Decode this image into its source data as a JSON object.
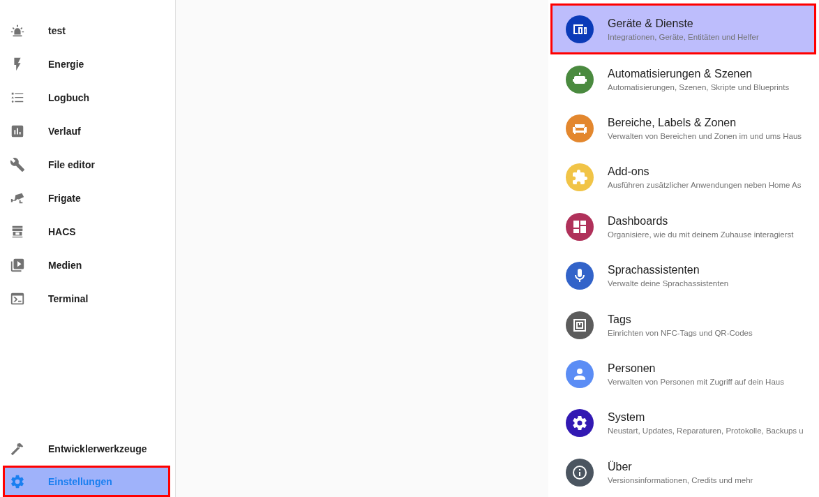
{
  "sidebar": {
    "items": [
      {
        "kind": "alarm",
        "label": "test",
        "selected": false
      },
      {
        "kind": "flash",
        "label": "Energie",
        "selected": false
      },
      {
        "kind": "list",
        "label": "Logbuch",
        "selected": false
      },
      {
        "kind": "chart",
        "label": "Verlauf",
        "selected": false
      },
      {
        "kind": "wrench",
        "label": "File editor",
        "selected": false
      },
      {
        "kind": "camera",
        "label": "Frigate",
        "selected": false
      },
      {
        "kind": "store",
        "label": "HACS",
        "selected": false
      },
      {
        "kind": "media",
        "label": "Medien",
        "selected": false
      },
      {
        "kind": "console",
        "label": "Terminal",
        "selected": false
      }
    ],
    "bottom_items": [
      {
        "kind": "hammer",
        "label": "Entwicklerwerkzeuge",
        "selected": false
      },
      {
        "kind": "cog",
        "label": "Einstellungen",
        "selected": true
      }
    ]
  },
  "settings": {
    "items": [
      {
        "kind": "devices",
        "title": "Geräte & Dienste",
        "subtitle": "Integrationen, Geräte, Entitäten und Helfer",
        "color": "#0b3bb8",
        "selected": true
      },
      {
        "kind": "robot",
        "title": "Automatisierungen & Szenen",
        "subtitle": "Automatisierungen, Szenen, Skripte und Blueprints",
        "color": "#4a8a3f",
        "selected": false
      },
      {
        "kind": "sofa",
        "title": "Bereiche, Labels & Zonen",
        "subtitle": "Verwalten von Bereichen und Zonen im und ums Haus",
        "color": "#e3872e",
        "selected": false
      },
      {
        "kind": "puzzle",
        "title": "Add-ons",
        "subtitle": "Ausführen zusätzlicher Anwendungen neben Home As",
        "color": "#f1c447",
        "selected": false
      },
      {
        "kind": "dashboard",
        "title": "Dashboards",
        "subtitle": "Organisiere, wie du mit deinem Zuhause interagierst",
        "color": "#b0315a",
        "selected": false
      },
      {
        "kind": "mic",
        "title": "Sprachassistenten",
        "subtitle": "Verwalte deine Sprachassistenten",
        "color": "#3263c9",
        "selected": false
      },
      {
        "kind": "nfc",
        "title": "Tags",
        "subtitle": "Einrichten von NFC-Tags und QR-Codes",
        "color": "#5c5c5c",
        "selected": false
      },
      {
        "kind": "person",
        "title": "Personen",
        "subtitle": "Verwalten von Personen mit Zugriff auf dein Haus",
        "color": "#5b8df5",
        "selected": false
      },
      {
        "kind": "cog",
        "title": "System",
        "subtitle": "Neustart, Updates, Reparaturen, Protokolle, Backups u",
        "color": "#3219b3",
        "selected": false
      },
      {
        "kind": "info",
        "title": "Über",
        "subtitle": "Versionsinformationen, Credits und mehr",
        "color": "#4b5560",
        "selected": false
      }
    ]
  }
}
